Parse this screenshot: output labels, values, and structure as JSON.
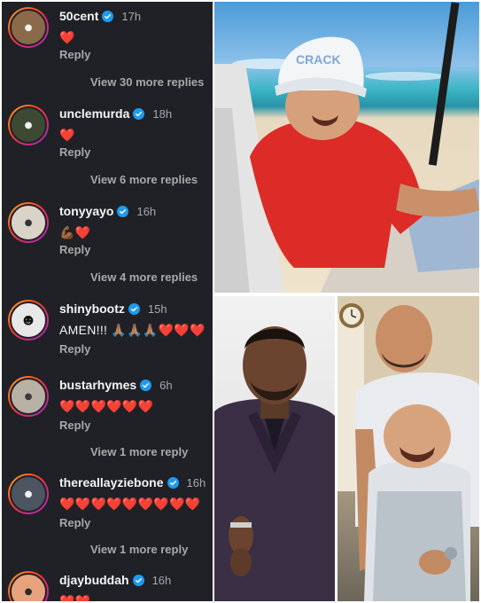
{
  "comments": [
    {
      "username": "50cent",
      "time": "17h",
      "text": "❤️",
      "reply": "Reply",
      "more": "View 30 more replies"
    },
    {
      "username": "unclemurda",
      "time": "18h",
      "text": "❤️",
      "reply": "Reply",
      "more": "View 6 more replies"
    },
    {
      "username": "tonyyayo",
      "time": "16h",
      "text": "💪🏾❤️",
      "reply": "Reply",
      "more": "View 4 more replies"
    },
    {
      "username": "shinybootz",
      "time": "15h",
      "text": "AMEN!!! 🙏🏽🙏🏽🙏🏽❤️❤️❤️",
      "reply": "Reply",
      "more": ""
    },
    {
      "username": "bustarhymes",
      "time": "6h",
      "text": "❤️❤️❤️❤️❤️❤️",
      "reply": "Reply",
      "more": "View 1 more reply"
    },
    {
      "username": "thereallayziebone",
      "time": "16h",
      "text": "❤️❤️❤️❤️❤️❤️❤️❤️❤️",
      "reply": "Reply",
      "more": "View 1 more reply"
    },
    {
      "username": "djaybuddah",
      "time": "16h",
      "text": "❤️❤️",
      "reply": "",
      "more": ""
    }
  ],
  "beach_photo": {
    "cap_text": "CRACK"
  },
  "colors": {
    "panel_bg": "#202126",
    "verified_blue": "#1d9bf0",
    "heart_red": "#e0242b"
  }
}
